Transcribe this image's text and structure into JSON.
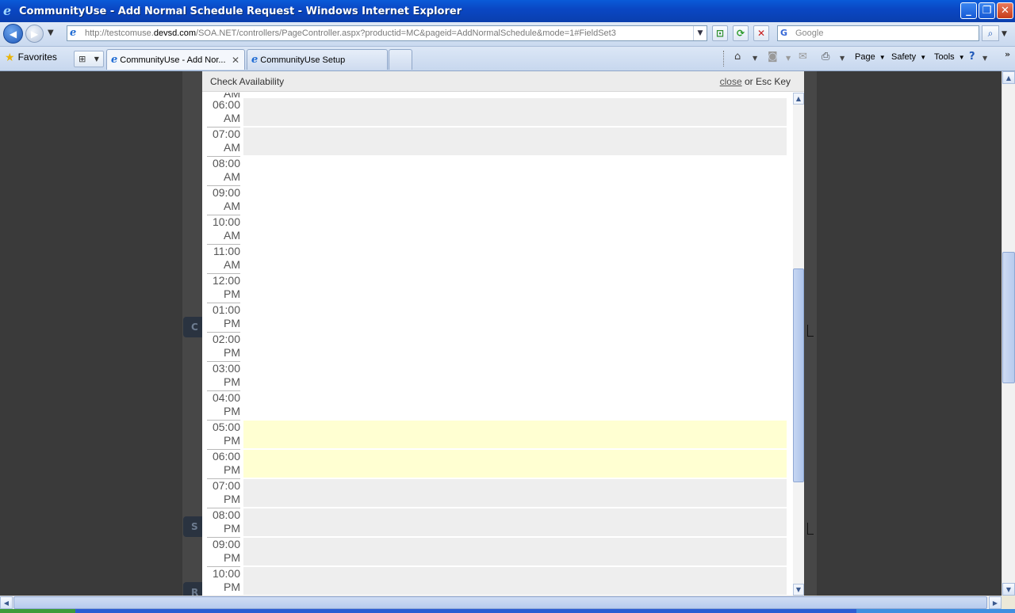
{
  "window": {
    "title": "CommunityUse - Add Normal Schedule Request - Windows Internet Explorer",
    "minimize": "_",
    "restore": "❐",
    "close": "✕"
  },
  "navigation": {
    "url_prefix": "http://testcomuse.",
    "url_host": "devsd.com",
    "url_path": "/SOA.NET/controllers/PageController.aspx?productid=MC&pageid=AddNormalSchedule&mode=1#FieldSet3",
    "search_placeholder": "Google"
  },
  "favorites": {
    "label": "Favorites"
  },
  "tabs": [
    {
      "label": "CommunityUse - Add Nor...",
      "active": true
    },
    {
      "label": "CommunityUse Setup",
      "active": false
    }
  ],
  "commands": {
    "page": "Page",
    "safety": "Safety",
    "tools": "Tools"
  },
  "modal": {
    "title": "Check Availability",
    "close_link": "close",
    "close_suffix": " or Esc Key",
    "partial_label": "AM",
    "slots": [
      {
        "time": "06:00",
        "period": "AM",
        "state": "grey"
      },
      {
        "time": "07:00",
        "period": "AM",
        "state": "grey"
      },
      {
        "time": "08:00",
        "period": "AM",
        "state": "white"
      },
      {
        "time": "09:00",
        "period": "AM",
        "state": "white"
      },
      {
        "time": "10:00",
        "period": "AM",
        "state": "white"
      },
      {
        "time": "11:00",
        "period": "AM",
        "state": "white"
      },
      {
        "time": "12:00",
        "period": "PM",
        "state": "white"
      },
      {
        "time": "01:00",
        "period": "PM",
        "state": "white"
      },
      {
        "time": "02:00",
        "period": "PM",
        "state": "white"
      },
      {
        "time": "03:00",
        "period": "PM",
        "state": "white"
      },
      {
        "time": "04:00",
        "period": "PM",
        "state": "white"
      },
      {
        "time": "05:00",
        "period": "PM",
        "state": "yellow"
      },
      {
        "time": "06:00",
        "period": "PM",
        "state": "yellow"
      },
      {
        "time": "07:00",
        "period": "PM",
        "state": "grey"
      },
      {
        "time": "08:00",
        "period": "PM",
        "state": "grey"
      },
      {
        "time": "09:00",
        "period": "PM",
        "state": "grey"
      },
      {
        "time": "10:00",
        "period": "PM",
        "state": "grey"
      }
    ]
  },
  "background": {
    "stub_letters": [
      "C",
      "S",
      "R"
    ]
  },
  "colors": {
    "titlebar": "#0a47c4",
    "slot_grey": "#eeeeee",
    "slot_yellow": "#ffffd2"
  }
}
